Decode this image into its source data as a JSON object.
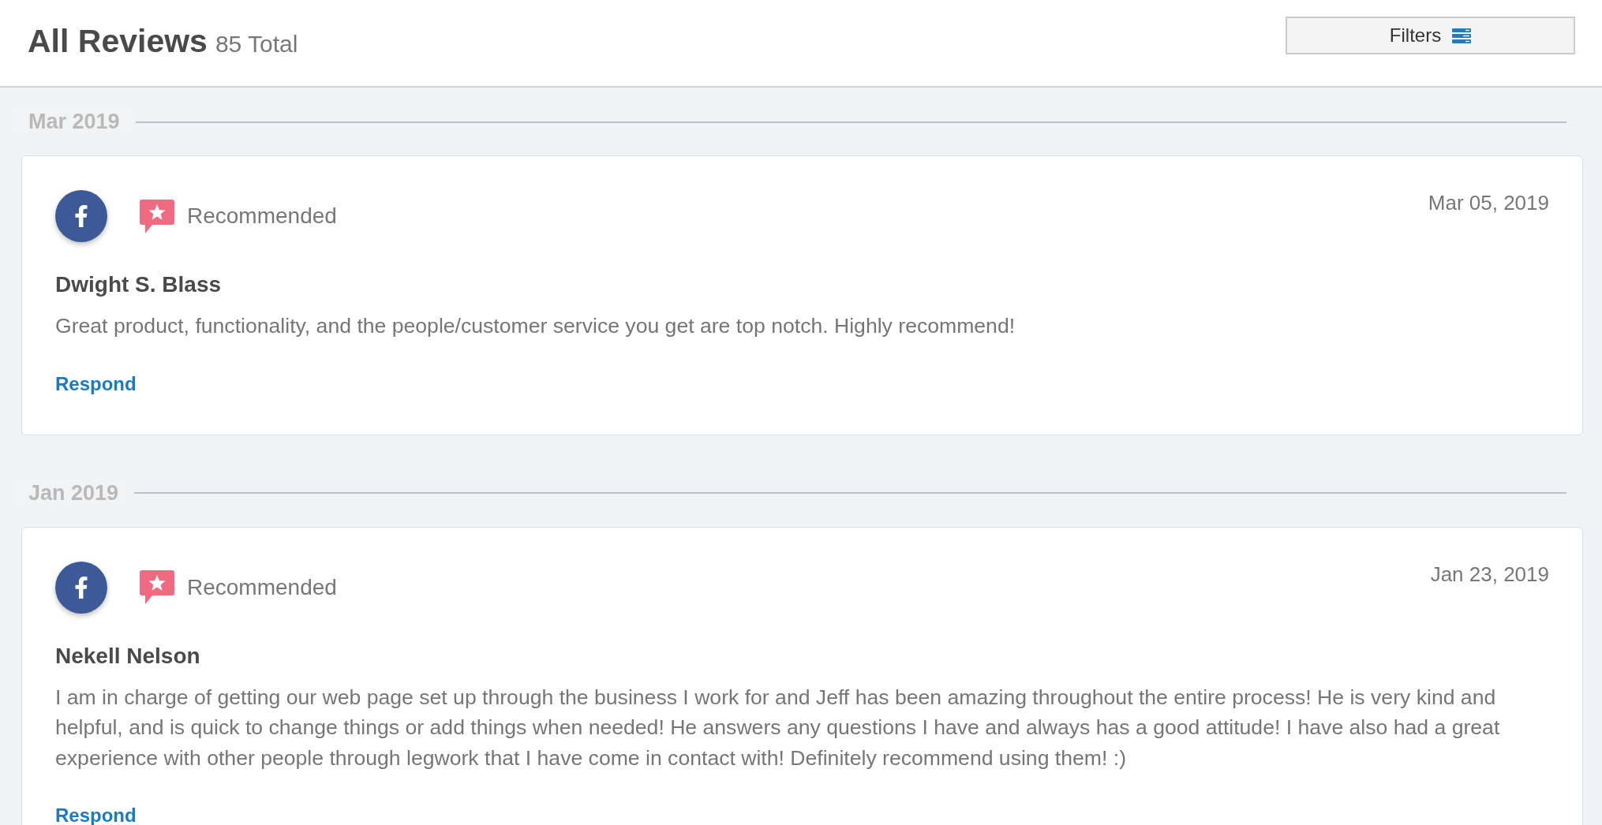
{
  "header": {
    "title": "All Reviews",
    "total": "85 Total",
    "filters_button": {
      "label": "Filters"
    }
  },
  "groups": [
    {
      "month": "Mar 2019",
      "reviews": [
        {
          "source": {
            "kind": "facebook"
          },
          "badge": {
            "kind": "recommended",
            "label": "Recommended"
          },
          "date": "Mar 05, 2019",
          "author": "Dwight S. Blass",
          "text": "Great product, functionality, and the people/customer service you get are top notch. Highly recommend!",
          "action": "Respond"
        }
      ]
    },
    {
      "month": "Jan 2019",
      "reviews": [
        {
          "source": {
            "kind": "facebook"
          },
          "badge": {
            "kind": "recommended",
            "label": "Recommended"
          },
          "date": "Jan 23, 2019",
          "author": "Nekell Nelson",
          "text": "I am in charge of getting our web page set up through the business I work for and Jeff has been amazing throughout the entire process! He is very kind and helpful, and is quick to change things or add things when needed! He answers any questions I have and always has a good attitude! I have also had a great experience with other people through legwork that I have come in contact with! Definitely recommend using them! :)",
          "action": "Respond"
        }
      ]
    }
  ]
}
